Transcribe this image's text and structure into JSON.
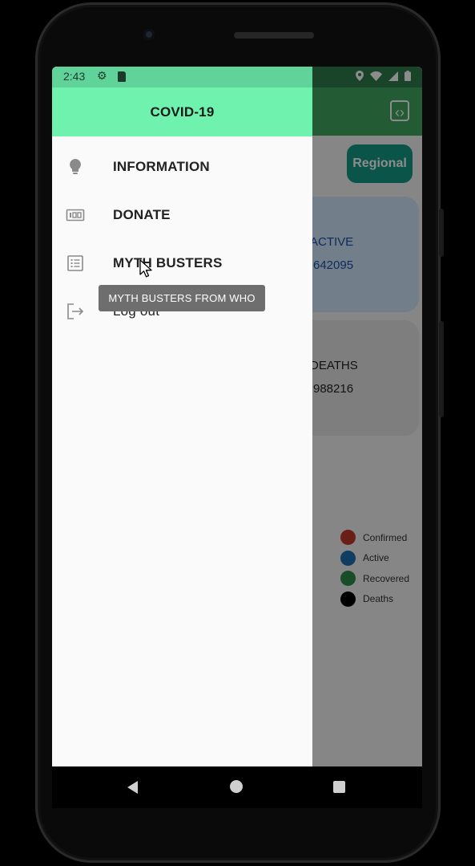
{
  "status_bar": {
    "time": "2:43"
  },
  "app": {
    "regional_button": "Regional",
    "cards": {
      "active": {
        "label": "ACTIVE",
        "value": "642095"
      },
      "deaths": {
        "label": "DEATHS",
        "value": "988216"
      }
    },
    "legend": [
      {
        "label": "Confirmed",
        "color": "#c0392b"
      },
      {
        "label": "Active",
        "color": "#1f6fb2"
      },
      {
        "label": "Recovered",
        "color": "#2e8b4a"
      },
      {
        "label": "Deaths",
        "color": "#000000"
      }
    ]
  },
  "drawer": {
    "title": "COVID-19",
    "items": [
      {
        "label": "INFORMATION",
        "icon": "lightbulb-icon"
      },
      {
        "label": "DONATE",
        "icon": "donate-icon"
      },
      {
        "label": "MYTH BUSTERS",
        "icon": "list-icon"
      },
      {
        "label": "Log out",
        "icon": "logout-icon"
      }
    ]
  },
  "tooltip": {
    "text": "MYTH BUSTERS FROM WHO"
  },
  "colors": {
    "drawer_header": "#6ef2ae",
    "toolbar": "#3ea660",
    "accent": "#149a86"
  }
}
